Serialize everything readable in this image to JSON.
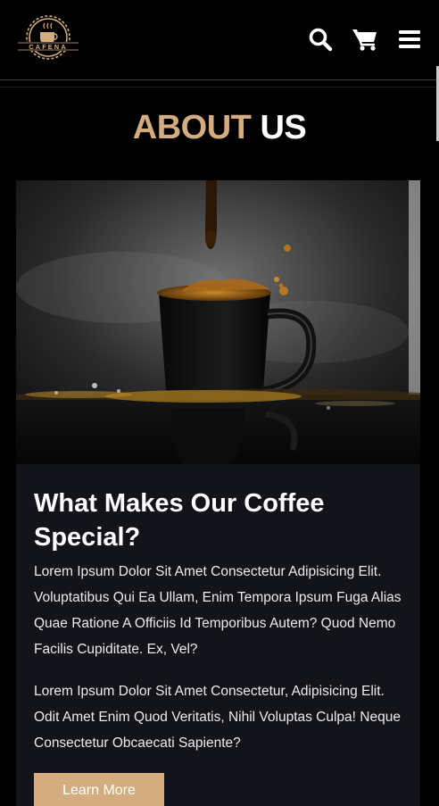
{
  "brand": {
    "logo_text": "CAFENA"
  },
  "header": {
    "icons": [
      "search-icon",
      "cart-icon",
      "menu-icon"
    ]
  },
  "section": {
    "title_accent": "ABOUT",
    "title_rest": "US"
  },
  "card": {
    "heading": "What Makes Our Coffee Special?",
    "paragraph1": "Lorem Ipsum Dolor Sit Amet Consectetur Adipisicing Elit. Voluptatibus Qui Ea Ullam, Enim Tempora Ipsum Fuga Alias Quae Ratione A Officiis Id Temporibus Autem? Quod Nemo Facilis Cupiditate. Ex, Vel?",
    "paragraph2": "Lorem Ipsum Dolor Sit Amet Consectetur, Adipisicing Elit. Odit Amet Enim Quod Veritatis, Nihil Voluptas Culpa! Neque Consectetur Obcaecati Sapiente?",
    "button_label": "Learn More"
  },
  "colors": {
    "accent": "#d3ad7f",
    "background": "#000000",
    "card": "#13131a"
  }
}
